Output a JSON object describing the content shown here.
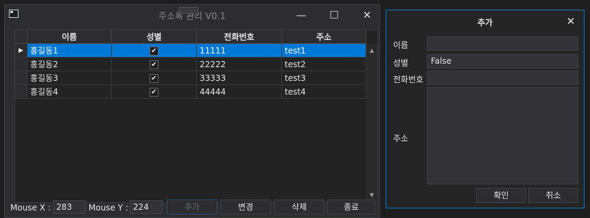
{
  "main_window": {
    "title": "주소록 관리 V0.1",
    "controls": {
      "minimize": "—",
      "maximize": "☐",
      "close": "✕"
    }
  },
  "grid": {
    "columns": [
      "이름",
      "성별",
      "전화번호",
      "주소"
    ],
    "rows": [
      {
        "name": "홍길동1",
        "gender_checked": true,
        "phone": "11111",
        "address": "test1",
        "selected": true
      },
      {
        "name": "홍길동2",
        "gender_checked": true,
        "phone": "22222",
        "address": "test2",
        "selected": false
      },
      {
        "name": "홍길동3",
        "gender_checked": true,
        "phone": "33333",
        "address": "test3",
        "selected": false
      },
      {
        "name": "홍길동4",
        "gender_checked": true,
        "phone": "44444",
        "address": "test4",
        "selected": false
      }
    ],
    "check_glyph": "✔",
    "row_indicator": "▶",
    "scroll_up": "▲",
    "scroll_down": "▼"
  },
  "bottom": {
    "mouse_x_label": "Mouse X :",
    "mouse_x_value": "283",
    "mouse_y_label": "Mouse Y :",
    "mouse_y_value": "224",
    "add_label": "추가",
    "edit_label": "변경",
    "delete_label": "삭제",
    "exit_label": "종료"
  },
  "dialog": {
    "title": "추가",
    "close": "✕",
    "name_label": "이름",
    "name_value": "",
    "gender_label": "성별",
    "gender_value": "False",
    "phone_label": "전화번호",
    "phone_value": "",
    "address_label": "주소",
    "address_value": "",
    "ok_label": "확인",
    "cancel_label": "취소"
  },
  "colors": {
    "selection": "#0078d7",
    "dialog_border": "#007acc",
    "background": "#2d2d30"
  }
}
